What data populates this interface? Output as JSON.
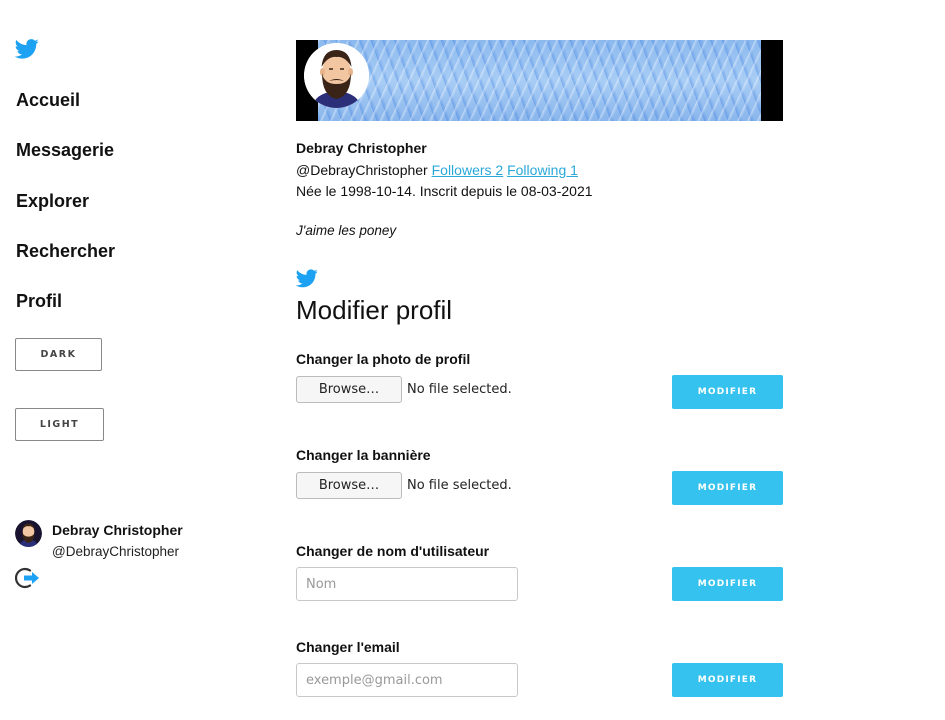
{
  "sidebar": {
    "logo_icon": "bird-icon",
    "nav": [
      {
        "label": "Accueil"
      },
      {
        "label": "Messagerie"
      },
      {
        "label": "Explorer"
      },
      {
        "label": "Rechercher"
      },
      {
        "label": "Profil"
      }
    ],
    "theme_buttons": {
      "dark": "DARK",
      "light": "LIGHT"
    },
    "user": {
      "name": "Debray Christopher",
      "handle": "@DebrayChristopher"
    },
    "logout_icon": "logout-icon"
  },
  "profile": {
    "name": "Debray Christopher",
    "handle": "@DebrayChristopher",
    "followers_link": "Followers 2",
    "following_link": "Following 1",
    "dates": "Née le 1998-10-14. Inscrit depuis le 08-03-2021",
    "bio": "J'aime les poney"
  },
  "edit": {
    "title": "Modifier profil",
    "photo": {
      "label": "Changer la photo de profil",
      "browse": "Browse…",
      "status": "No file selected.",
      "button": "MODIFIER"
    },
    "banner": {
      "label": "Changer la bannière",
      "browse": "Browse…",
      "status": "No file selected.",
      "button": "MODIFIER"
    },
    "username": {
      "label": "Changer de nom d'utilisateur",
      "placeholder": "Nom",
      "value": "",
      "button": "MODIFIER"
    },
    "email": {
      "label": "Changer l'email",
      "placeholder": "exemple@gmail.com",
      "value": "",
      "button": "MODIFIER"
    }
  },
  "colors": {
    "accent": "#35c2ef",
    "link": "#2aa8d8",
    "twitter_blue": "#1da1f2"
  }
}
